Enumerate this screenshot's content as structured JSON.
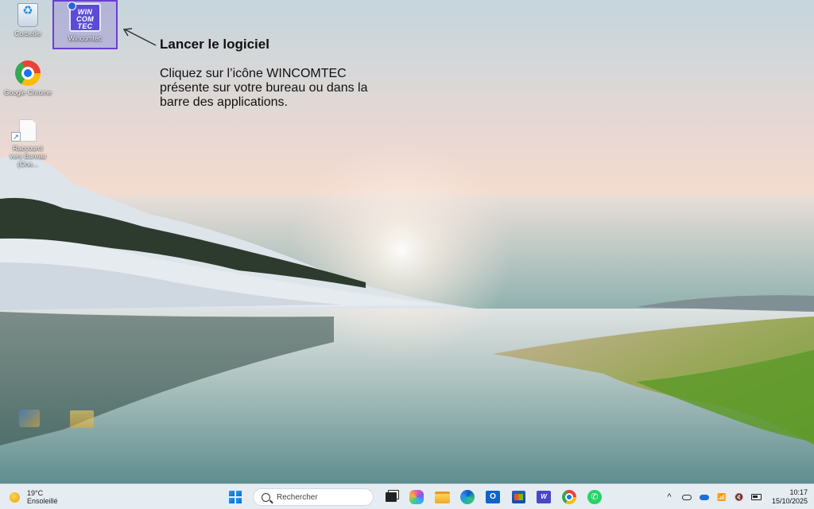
{
  "desktop": {
    "icons": [
      {
        "label": "Corbeille",
        "icon": "recycle-bin-icon"
      },
      {
        "label": "Wincomtec",
        "icon": "wincomtec-icon",
        "logo_text": [
          "WIN",
          "COM",
          "TEC"
        ],
        "selected": true
      },
      {
        "label": "Google Chrome",
        "icon": "chrome-icon"
      },
      {
        "label": "Raccourci vers Bureau (One...",
        "icon": "file-shortcut-icon"
      }
    ]
  },
  "annotation": {
    "title": "Lancer le logiciel",
    "body": "Cliquez sur l’icône WINCOMTEC présente sur votre bureau ou dans la barre des applications."
  },
  "taskbar": {
    "weather": {
      "temperature": "19°C",
      "condition": "Ensoleillé",
      "icon": "sun-icon"
    },
    "search": {
      "placeholder": "Rechercher"
    },
    "pinned_apps": [
      "start-icon",
      "task-view-icon",
      "copilot-icon",
      "file-explorer-icon",
      "edge-icon",
      "outlook-icon",
      "store-icon",
      "wincomtec-taskbar-icon",
      "chrome-icon",
      "whatsapp-icon"
    ],
    "outlook_letter": "O",
    "wincomtec_short": "W",
    "whatsapp_glyph": "✆",
    "tray": {
      "chevron": "^",
      "mute_glyph": "🔇",
      "wifi_glyph": "📶"
    },
    "clock": {
      "time": "10:17",
      "date": "15/10/2025"
    }
  },
  "colors": {
    "selection_border": "#6b3fd1",
    "taskbar_bg": "#e6edf2",
    "accent": "#0b63d1"
  }
}
